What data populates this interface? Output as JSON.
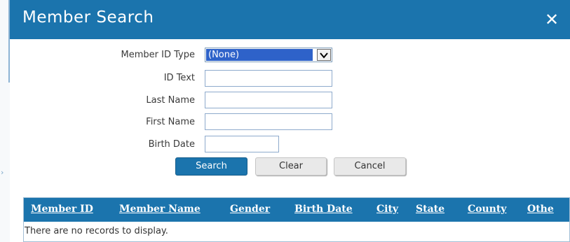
{
  "dialog": {
    "title": "Member Search",
    "close_label": "✕"
  },
  "form": {
    "member_id_type_label": "Member ID Type",
    "member_id_type_value": "(None)",
    "id_text_label": "ID Text",
    "id_text_value": "",
    "last_name_label": "Last Name",
    "last_name_value": "",
    "first_name_label": "First Name",
    "first_name_value": "",
    "birth_date_label": "Birth Date",
    "birth_date_value": ""
  },
  "buttons": {
    "search": "Search",
    "clear": "Clear",
    "cancel": "Cancel"
  },
  "grid": {
    "columns": [
      "Member ID",
      "Member Name",
      "Gender",
      "Birth Date",
      "City",
      "State",
      "County",
      "Othe"
    ],
    "empty_message": "There are no records to display."
  },
  "colors": {
    "accent": "#1b74ad",
    "selection": "#2e62c9"
  }
}
